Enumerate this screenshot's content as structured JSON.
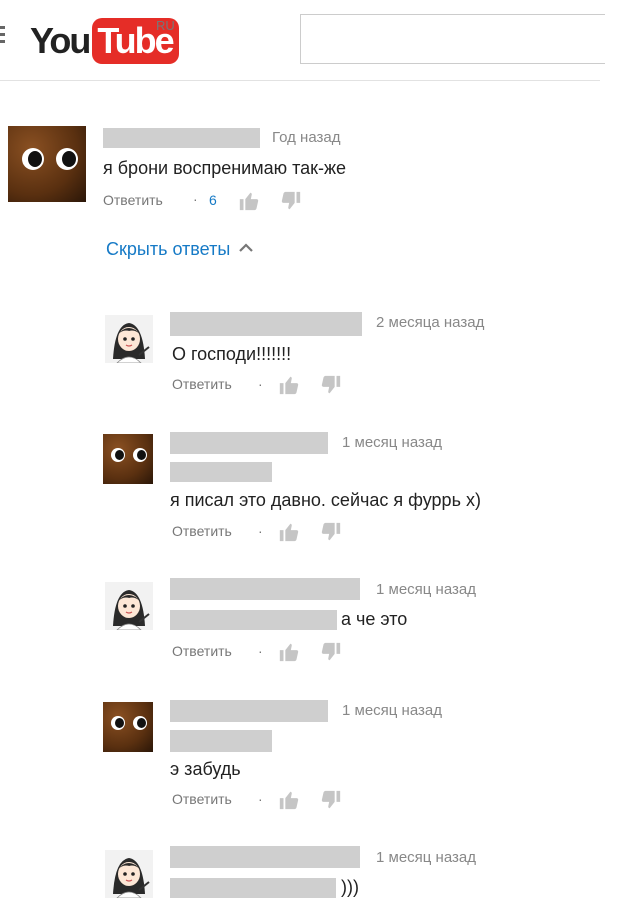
{
  "header": {
    "logo_you": "You",
    "logo_tube": "Tube",
    "region": "RU",
    "search_value": ""
  },
  "main_comment": {
    "time": "Год назад",
    "text": "я брони воспренимаю так-же",
    "reply_label": "Ответить",
    "separator": "·",
    "likes": "6",
    "hide_replies": "Скрыть ответы",
    "hide_icon": "chevron-up-icon"
  },
  "replies": [
    {
      "time": "2 месяца назад",
      "text": "О господи!!!!!!!",
      "reply_label": "Ответить",
      "separator": "·"
    },
    {
      "time": "1 месяц назад",
      "text": "я писал это давно. сейчас я фуррь х)",
      "reply_label": "Ответить",
      "separator": "·"
    },
    {
      "time": "1 месяц назад",
      "text": "а че это",
      "reply_label": "Ответить",
      "separator": "·"
    },
    {
      "time": "1 месяц назад",
      "text": "э забудь",
      "reply_label": "Ответить",
      "separator": "·"
    },
    {
      "time": "1 месяц назад",
      "text": ")))"
    }
  ],
  "colors": {
    "brand_red": "#e52d27",
    "link_blue": "#167ac6",
    "redaction_gray": "#cfcfcf"
  }
}
